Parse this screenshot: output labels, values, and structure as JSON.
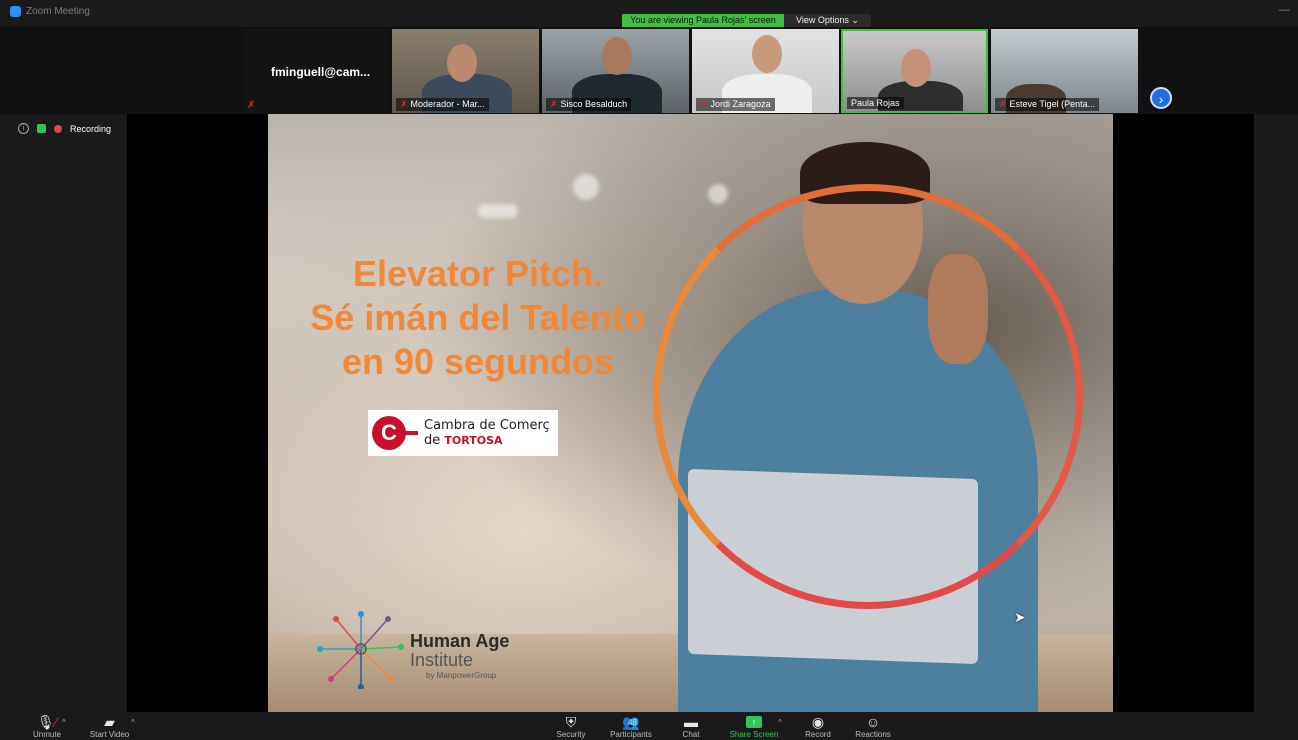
{
  "window": {
    "title": "Zoom Meeting",
    "viewing_banner": "You are viewing Paula Rojas' screen",
    "view_options": "View Options ⌄",
    "minimize": "—"
  },
  "thumbnails": [
    {
      "name": "fminguell@cam..."
    },
    {
      "name": "Moderador - Mar..."
    },
    {
      "name": "Sisco Besalduch"
    },
    {
      "name": "Jordi Zaragoza"
    },
    {
      "name": "Paula Rojas"
    },
    {
      "name": "Esteve Tigel (Penta..."
    }
  ],
  "recording": {
    "label": "Recording"
  },
  "slide": {
    "title_line1": "Elevator Pitch.",
    "title_line2": "Sé imán del Talento",
    "title_line3": "en 90 segundos",
    "cambra_line1": "Cambra de Comerç",
    "cambra_line2_prefix": "de ",
    "cambra_line2_brand": "TORTOSA",
    "hai_line1": "Human Age",
    "hai_line2": "Institute",
    "hai_line3": "by ManpowerGroup"
  },
  "toolbar": {
    "unmute": "Unmute",
    "start_video": "Start Video",
    "security": "Security",
    "participants": "Participants",
    "participants_count": "48",
    "chat": "Chat",
    "share_screen": "Share Screen",
    "record": "Record",
    "reactions": "Reactions"
  },
  "colors": {
    "share_green": "#3fbf3f",
    "slide_title": "#f0883a",
    "circle": "#e25a45",
    "next_button": "#1e6fe0"
  }
}
